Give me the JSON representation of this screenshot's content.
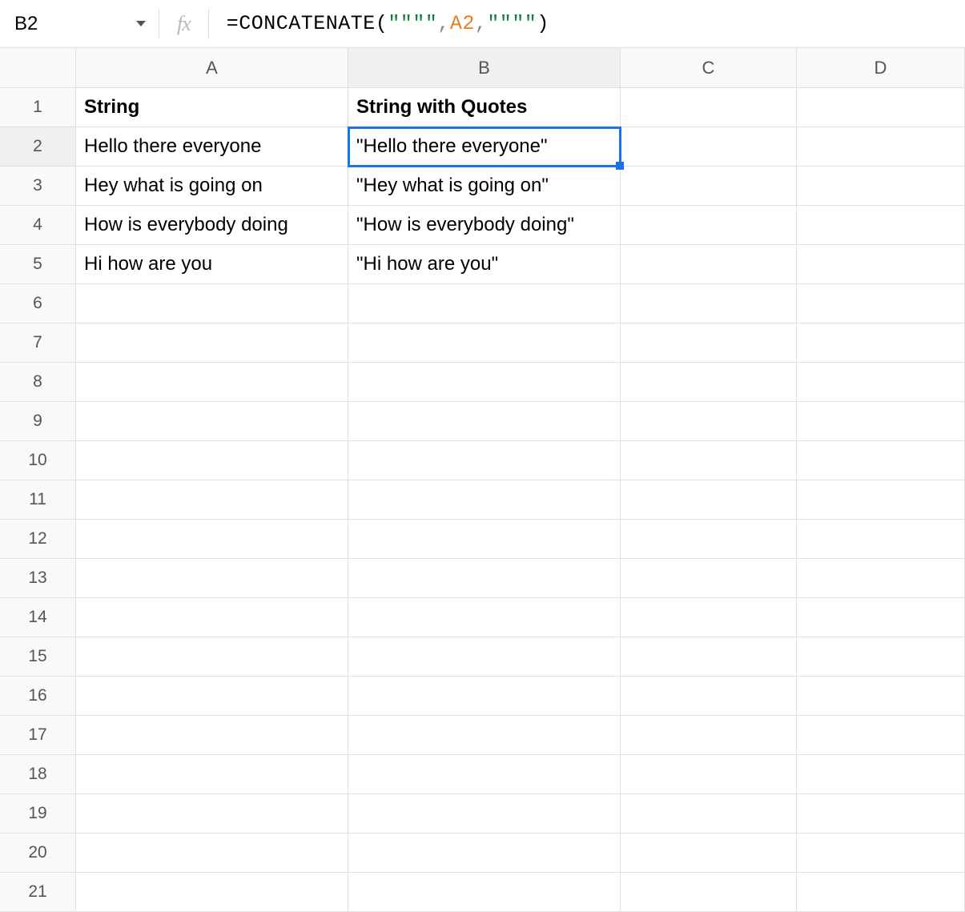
{
  "namebox": {
    "value": "B2"
  },
  "fx_label": "fx",
  "formula": {
    "eq": "=",
    "fn": "CONCATENATE",
    "open": "(",
    "arg1": "\"\"\"\"",
    "comma1": ",",
    "ref": "A2",
    "comma2": ",",
    "arg3": "\"\"\"\"",
    "close": ")"
  },
  "columns": [
    "A",
    "B",
    "C",
    "D"
  ],
  "active_column_index": 1,
  "row_count": 21,
  "active_row": 2,
  "selected_cell": "B2",
  "cells": {
    "A1": {
      "text": "String",
      "bold": true
    },
    "B1": {
      "text": "String with Quotes",
      "bold": true
    },
    "A2": {
      "text": "Hello there everyone"
    },
    "B2": {
      "text": "\"Hello there everyone\""
    },
    "A3": {
      "text": "Hey what is going on"
    },
    "B3": {
      "text": "\"Hey what is going on\""
    },
    "A4": {
      "text": "How is everybody doing"
    },
    "B4": {
      "text": "\"How is everybody doing\""
    },
    "A5": {
      "text": "Hi how are you"
    },
    "B5": {
      "text": "\"Hi how are you\""
    }
  }
}
